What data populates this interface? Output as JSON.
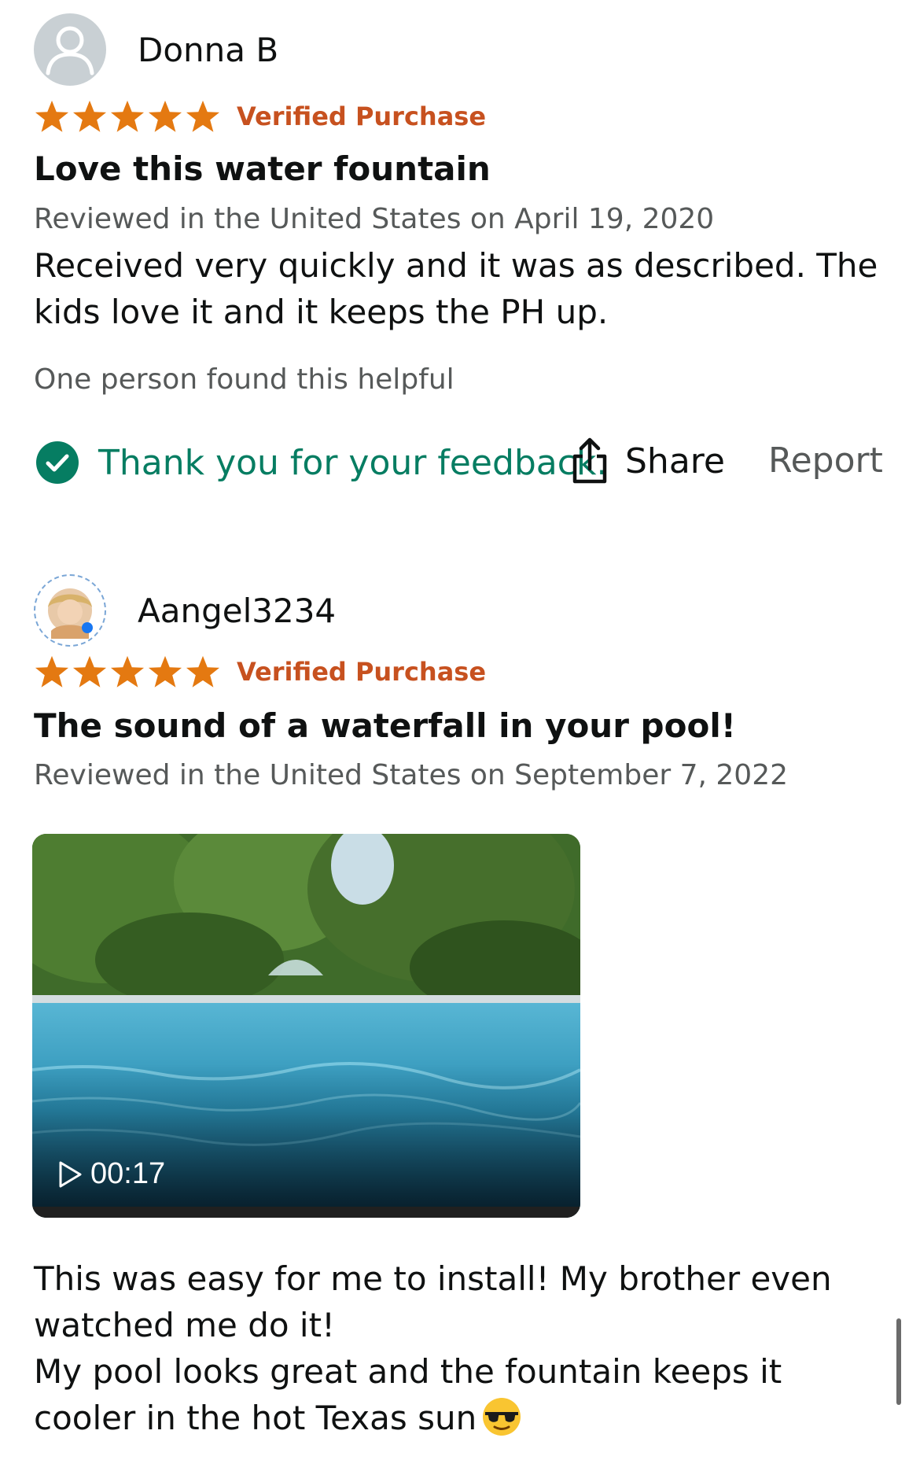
{
  "reviews": [
    {
      "reviewer": "Donna B",
      "avatar": "generic-person-icon",
      "rating": 5,
      "verified_label": "Verified Purchase",
      "title": "Love this water fountain",
      "date_line": "Reviewed in the United States on April 19, 2020",
      "body": "Received very quickly and it was as described. The kids love it and it keeps the PH up.",
      "helpful": "One person found this helpful",
      "feedback": "Thank you for your feedback.",
      "share_label": "Share",
      "report_label": "Report"
    },
    {
      "reviewer": "Aangel3234",
      "avatar": "profile-photo",
      "rating": 5,
      "verified_label": "Verified Purchase",
      "title": "The sound of a waterfall in your pool!",
      "date_line": "Reviewed in the United States on September 7, 2022",
      "video": {
        "duration": "00:17"
      },
      "body_line1": "This was easy for me to install! My brother even watched me do it!",
      "body_line2": "My pool looks great and the fountain keeps it cooler in the hot Texas sun"
    }
  ],
  "colors": {
    "star": "#e47911",
    "verified": "#c7511f",
    "feedback_green": "#067d62",
    "secondary_text": "#565959"
  }
}
